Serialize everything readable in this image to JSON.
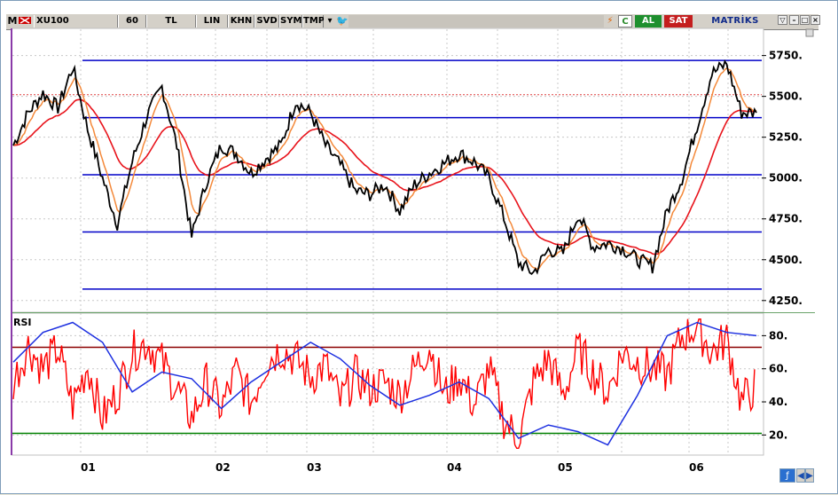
{
  "toolbar": {
    "logo": "M",
    "symbol": "XU100",
    "period": "60",
    "currency": "TL",
    "scale": "LIN",
    "khn": "KHN",
    "svd": "SVD",
    "sym": "SYM",
    "tmp": "TMP",
    "c_button": "C",
    "buy": "AL",
    "sell": "SAT",
    "brand": "MATRİKS"
  },
  "price_axis": [
    "5750.",
    "5500.",
    "5250.",
    "5000.",
    "4750.",
    "4500.",
    "4250."
  ],
  "rsi_axis": [
    "80.",
    "60.",
    "40.",
    "20."
  ],
  "rsi_panel": {
    "title": "RSI"
  },
  "dates": [
    "01",
    "02",
    "03",
    "04",
    "05",
    "06"
  ],
  "colors": {
    "price": "#000000",
    "ma_fast": "#f4893a",
    "ma_slow": "#e8131b",
    "levels": "#0000c8",
    "rsi": "#ff0000",
    "rsi_signal": "#1d30e0",
    "rsi_upper": "#8b0000",
    "rsi_lower": "#008000"
  },
  "chart_data": [
    {
      "type": "line",
      "title": "XU100",
      "ylim": [
        4200,
        5900
      ],
      "yticks": [
        4250,
        4500,
        4750,
        5000,
        5250,
        5500,
        5750
      ],
      "support_resistance": [
        5720,
        5370,
        5020,
        4670,
        4320
      ],
      "dashed_level": 5510,
      "series": [
        {
          "name": "XU100",
          "x": [
            0,
            2,
            4,
            6,
            8,
            10,
            12,
            14,
            16,
            18,
            20,
            22,
            24,
            26,
            28,
            30,
            32,
            34,
            36,
            38,
            40,
            42,
            44,
            46,
            48,
            50,
            52,
            54,
            56,
            58,
            60,
            62,
            64,
            66,
            68,
            70,
            72,
            74,
            76,
            78,
            80,
            82,
            84,
            86,
            88,
            90,
            92,
            94,
            96,
            98,
            100
          ],
          "values": [
            5200,
            5400,
            5520,
            5430,
            5680,
            5300,
            5000,
            4720,
            5100,
            5380,
            5560,
            5200,
            4640,
            4980,
            5200,
            5150,
            5030,
            5120,
            5200,
            5470,
            5400,
            5200,
            5080,
            4920,
            4900,
            4960,
            4800,
            4960,
            5030,
            5090,
            5150,
            5100,
            5000,
            4760,
            4480,
            4420,
            4560,
            4540,
            4780,
            4580,
            4600,
            4570,
            4500,
            4460,
            4800,
            5000,
            5320,
            5640,
            5700,
            5400,
            5400
          ]
        }
      ]
    },
    {
      "type": "line",
      "title": "RSI",
      "ylim": [
        10,
        92
      ],
      "yticks": [
        20,
        40,
        60,
        80
      ],
      "levels": [
        73,
        21
      ],
      "series": [
        {
          "name": "RSI",
          "x": [
            0,
            2,
            4,
            6,
            8,
            10,
            12,
            14,
            16,
            18,
            20,
            22,
            24,
            26,
            28,
            30,
            32,
            34,
            36,
            38,
            40,
            42,
            44,
            46,
            48,
            50,
            52,
            54,
            56,
            58,
            60,
            62,
            64,
            66,
            68,
            70,
            72,
            74,
            76,
            78,
            80,
            82,
            84,
            86,
            88,
            90,
            92,
            94,
            96,
            98,
            100
          ],
          "values": [
            52,
            74,
            60,
            72,
            38,
            62,
            30,
            45,
            70,
            76,
            64,
            48,
            30,
            52,
            36,
            58,
            40,
            64,
            72,
            66,
            55,
            62,
            40,
            56,
            48,
            52,
            44,
            60,
            74,
            44,
            56,
            38,
            60,
            30,
            16,
            52,
            66,
            44,
            72,
            58,
            46,
            70,
            64,
            60,
            56,
            80,
            86,
            70,
            78,
            40,
            50
          ]
        },
        {
          "name": "RSI-MA",
          "x": [
            0,
            4,
            8,
            12,
            16,
            20,
            24,
            28,
            32,
            36,
            40,
            44,
            48,
            52,
            56,
            60,
            64,
            68,
            72,
            76,
            80,
            84,
            88,
            92,
            96,
            100
          ],
          "values": [
            64,
            82,
            88,
            76,
            46,
            58,
            54,
            36,
            52,
            64,
            76,
            66,
            50,
            38,
            44,
            52,
            42,
            18,
            26,
            22,
            14,
            44,
            80,
            88,
            82,
            80
          ]
        }
      ]
    }
  ]
}
